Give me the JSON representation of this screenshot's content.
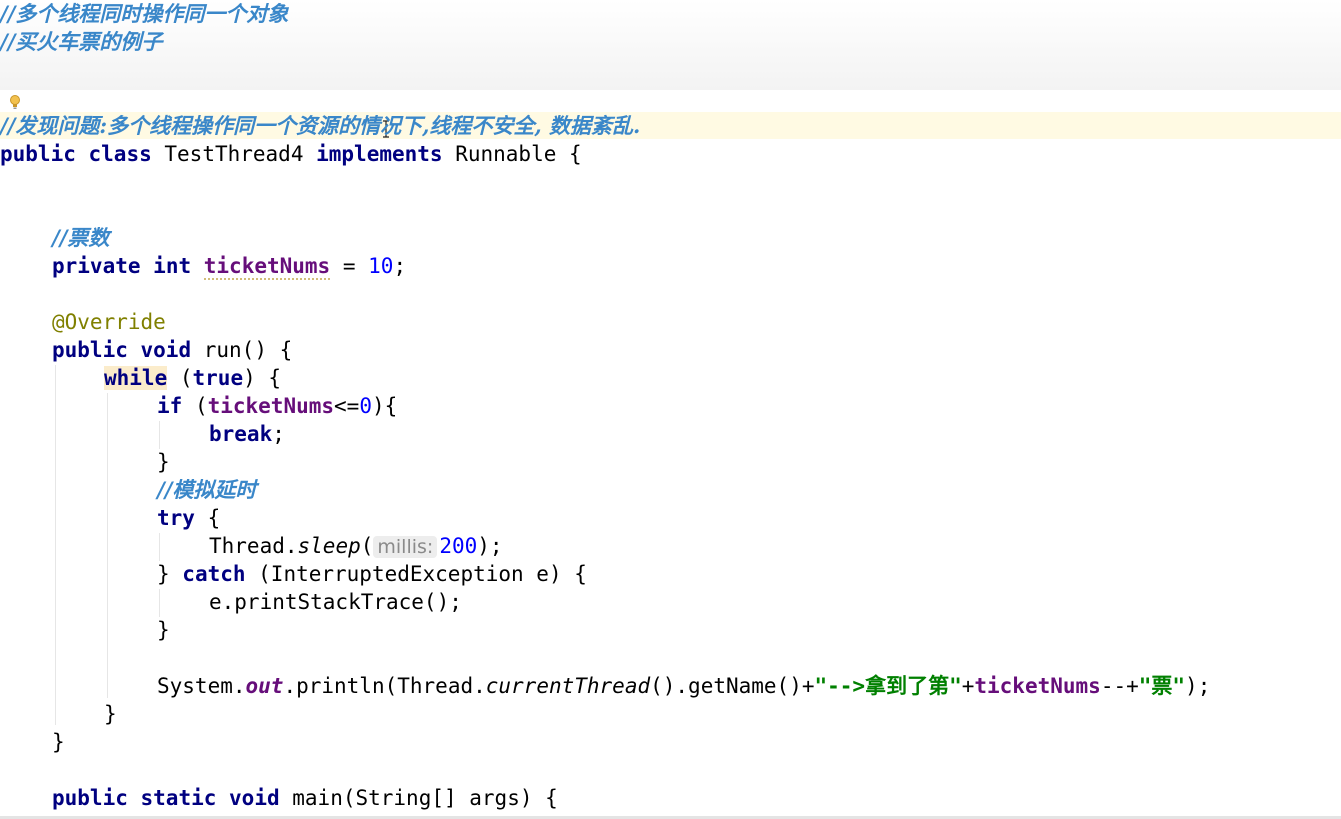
{
  "editor": {
    "comments": {
      "line1": "//多个线程同时操作同一个对象",
      "line2": "//买火车票的例子",
      "problem": "//发现问题:多个线程操作同一个资源的情况下,线程不安全, 数据紊乱.",
      "tickets": "//票数",
      "delay": "//模拟延时"
    },
    "keywords": {
      "public": "public",
      "class": "class",
      "implements": "implements",
      "private": "private",
      "int": "int",
      "void": "void",
      "while": "while",
      "true": "true",
      "if": "if",
      "break": "break",
      "try": "try",
      "catch": "catch",
      "static": "static"
    },
    "class_decl": {
      "name": "TestThread4",
      "iface": "Runnable",
      "open": " {"
    },
    "field": {
      "name": "ticketNums",
      "assign": " = ",
      "value": "10",
      "end": ";"
    },
    "annotation": "@Override",
    "run_sig": {
      "name": "run() {"
    },
    "while_line": {
      "open": " (",
      "close": ") {"
    },
    "if_line": {
      "open": " (",
      "op": "<=",
      "zero": "0",
      "close": "){"
    },
    "break_end": ";",
    "close_brace": "}",
    "try_open": " {",
    "sleep_line": {
      "obj": "Thread.",
      "method": "sleep",
      "paren": "(",
      "hint": "millis:",
      "arg": "200",
      "end": ");"
    },
    "catch_line": {
      "pre": "} ",
      "params": " (InterruptedException e) {"
    },
    "stack_line": "e.printStackTrace();",
    "println_line": {
      "sys": "System.",
      "out": "out",
      "p1": ".println(Thread.",
      "cur": "currentThread",
      "p2": "().getName()+",
      "s1": "\"-->拿到了第\"",
      "plus": "+",
      "fld": "ticketNums",
      "dec": "--+",
      "s2": "\"票\"",
      "end": ");"
    },
    "main_sig": {
      "rest": "main(String[] args) {"
    }
  },
  "icons": {
    "bulb": "lightbulb-icon",
    "cursor": "text-cursor-icon"
  },
  "colors": {
    "keyword": "#000080",
    "comment": "#3a87c9",
    "field": "#660e7a",
    "number": "#0000ff",
    "string": "#008000",
    "annotation": "#808000",
    "line_highlight": "#fffae3"
  }
}
